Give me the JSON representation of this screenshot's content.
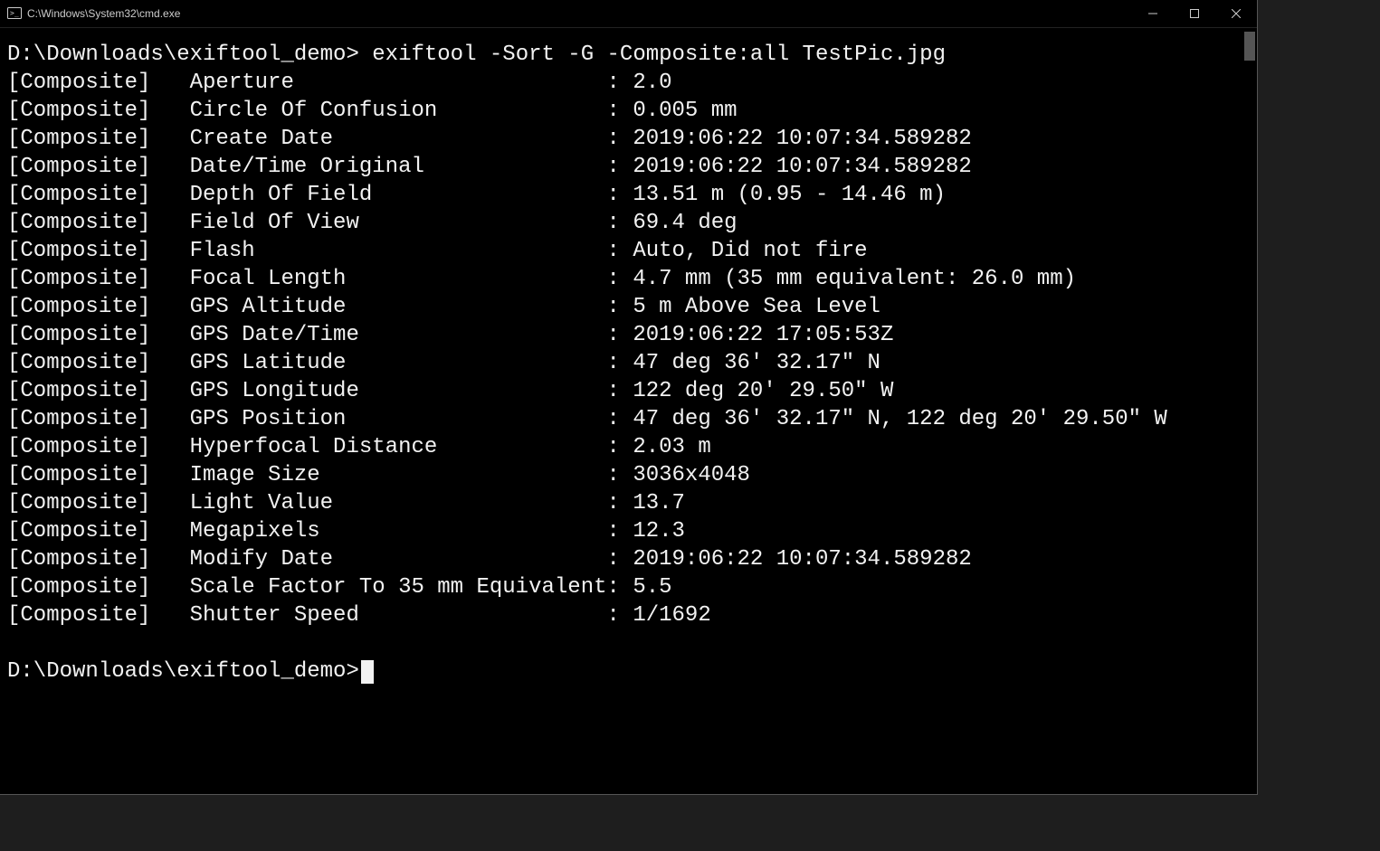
{
  "titlebar": {
    "title": "C:\\Windows\\System32\\cmd.exe"
  },
  "terminal": {
    "prompt1": "D:\\Downloads\\exiftool_demo> ",
    "command": "exiftool -Sort -G -Composite:all TestPic.jpg",
    "prompt2": "D:\\Downloads\\exiftool_demo>",
    "rows": [
      {
        "group": "[Composite]",
        "label": "Aperture",
        "sep": ": ",
        "val": "2.0"
      },
      {
        "group": "[Composite]",
        "label": "Circle Of Confusion",
        "sep": ": ",
        "val": "0.005 mm"
      },
      {
        "group": "[Composite]",
        "label": "Create Date",
        "sep": ": ",
        "val": "2019:06:22 10:07:34.589282"
      },
      {
        "group": "[Composite]",
        "label": "Date/Time Original",
        "sep": ": ",
        "val": "2019:06:22 10:07:34.589282"
      },
      {
        "group": "[Composite]",
        "label": "Depth Of Field",
        "sep": ": ",
        "val": "13.51 m (0.95 - 14.46 m)"
      },
      {
        "group": "[Composite]",
        "label": "Field Of View",
        "sep": ": ",
        "val": "69.4 deg"
      },
      {
        "group": "[Composite]",
        "label": "Flash",
        "sep": ": ",
        "val": "Auto, Did not fire"
      },
      {
        "group": "[Composite]",
        "label": "Focal Length",
        "sep": ": ",
        "val": "4.7 mm (35 mm equivalent: 26.0 mm)"
      },
      {
        "group": "[Composite]",
        "label": "GPS Altitude",
        "sep": ": ",
        "val": "5 m Above Sea Level"
      },
      {
        "group": "[Composite]",
        "label": "GPS Date/Time",
        "sep": ": ",
        "val": "2019:06:22 17:05:53Z"
      },
      {
        "group": "[Composite]",
        "label": "GPS Latitude",
        "sep": ": ",
        "val": "47 deg 36' 32.17\" N"
      },
      {
        "group": "[Composite]",
        "label": "GPS Longitude",
        "sep": ": ",
        "val": "122 deg 20' 29.50\" W"
      },
      {
        "group": "[Composite]",
        "label": "GPS Position",
        "sep": ": ",
        "val": "47 deg 36' 32.17\" N, 122 deg 20' 29.50\" W"
      },
      {
        "group": "[Composite]",
        "label": "Hyperfocal Distance",
        "sep": ": ",
        "val": "2.03 m"
      },
      {
        "group": "[Composite]",
        "label": "Image Size",
        "sep": ": ",
        "val": "3036x4048"
      },
      {
        "group": "[Composite]",
        "label": "Light Value",
        "sep": ": ",
        "val": "13.7"
      },
      {
        "group": "[Composite]",
        "label": "Megapixels",
        "sep": ": ",
        "val": "12.3"
      },
      {
        "group": "[Composite]",
        "label": "Modify Date",
        "sep": ": ",
        "val": "2019:06:22 10:07:34.589282"
      },
      {
        "group": "[Composite]",
        "label": "Scale Factor To 35 mm Equivalent",
        "sep": ": ",
        "val": "5.5"
      },
      {
        "group": "[Composite]",
        "label": "Shutter Speed",
        "sep": ": ",
        "val": "1/1692"
      }
    ]
  }
}
